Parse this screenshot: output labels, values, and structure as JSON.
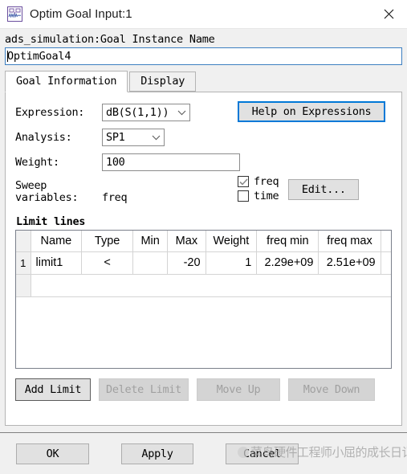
{
  "window": {
    "title": "Optim Goal Input:1",
    "icon": "schematic-waveform-icon",
    "close_label": "✕"
  },
  "instance": {
    "label": "ads_simulation:Goal Instance Name",
    "value": "OptimGoal4",
    "placeholder": "Goal Instance Name"
  },
  "tabs": [
    {
      "label": "Goal Information",
      "active": true
    },
    {
      "label": "Display",
      "active": false
    }
  ],
  "form": {
    "expression_label": "Expression:",
    "expression_value": "dB(S(1,1))",
    "analysis_label": "Analysis:",
    "analysis_value": "SP1",
    "weight_label": "Weight:",
    "weight_value": "100",
    "sweep_label_line1": "Sweep",
    "sweep_label_line2": "variables:",
    "sweep_value": "freq",
    "help_button": "Help on Expressions",
    "edit_button": "Edit...",
    "checkboxes": [
      {
        "label": "freq",
        "checked": true
      },
      {
        "label": "time",
        "checked": false
      }
    ]
  },
  "limit_lines": {
    "title": "Limit lines",
    "columns": [
      "",
      "Name",
      "Type",
      "Min",
      "Max",
      "Weight",
      "freq min",
      "freq max"
    ],
    "rows": [
      {
        "index": "1",
        "name": "limit1",
        "type": "<",
        "min": "",
        "max": "-20",
        "weight": "1",
        "freq_min": "2.29e+09",
        "freq_max": "2.51e+09"
      }
    ],
    "buttons": [
      {
        "label": "Add Limit",
        "enabled": true
      },
      {
        "label": "Delete Limit",
        "enabled": false
      },
      {
        "label": "Move Up",
        "enabled": false
      },
      {
        "label": "Move Down",
        "enabled": false
      }
    ]
  },
  "footer": {
    "ok": "OK",
    "apply": "Apply",
    "cancel": "Cancel"
  },
  "watermark": {
    "text": "菜鸟硬件工程师小屈的成长日记"
  },
  "colors": {
    "accent_blue": "#0078d7",
    "input_border_blue": "#3d7fc1",
    "panel_bg": "#f0f0f0",
    "button_face": "#e1e1e1",
    "disabled_text": "#a0a0a0"
  }
}
